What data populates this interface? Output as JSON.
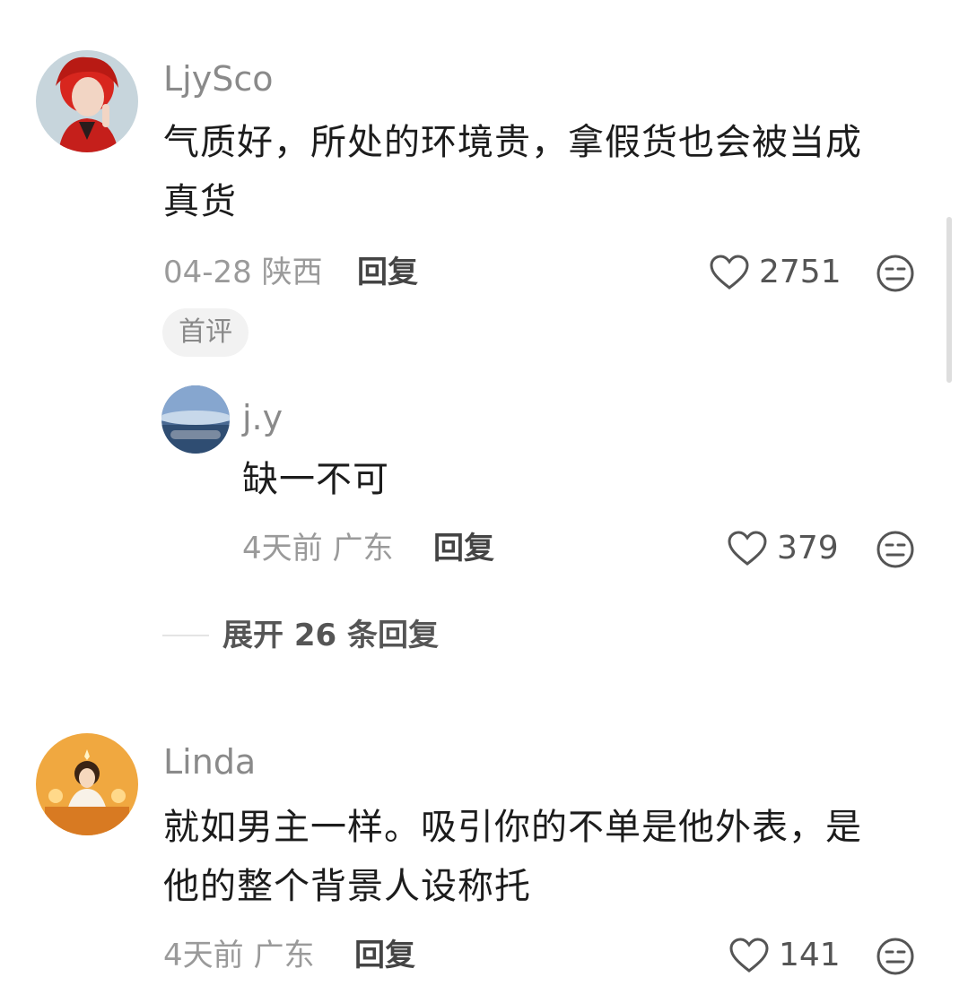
{
  "comments": [
    {
      "username": "LjySco",
      "text_line1": "气质好，所处的环境贵，拿假货也会被当成",
      "text_line2": "真货",
      "date": "04-28",
      "location": "陕西",
      "reply_label": "回复",
      "likes": "2751",
      "badge": "首评",
      "replies": [
        {
          "username": "j.y",
          "text": "缺一不可",
          "date": "4天前",
          "location": "广东",
          "reply_label": "回复",
          "likes": "379"
        }
      ],
      "expand_label": "展开 26 条回复"
    },
    {
      "username": "Linda",
      "text_line1": "就如男主一样。吸引你的不单是他外表，是",
      "text_line2": "他的整个背景人设称托",
      "date": "4天前",
      "location": "广东",
      "reply_label": "回复",
      "likes": "141"
    }
  ],
  "colors": {
    "background": "#ffffff",
    "username": "#8a8a8a",
    "text": "#1c1c1c",
    "meta": "#9a9a9a",
    "badge_bg": "#f2f2f2"
  },
  "icons": [
    "avatar-image",
    "heart-icon",
    "meh-face-icon"
  ]
}
